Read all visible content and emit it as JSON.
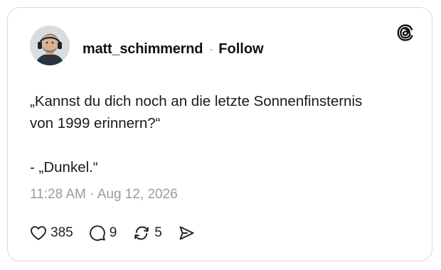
{
  "post": {
    "username": "matt_schimmernd",
    "separator": "·",
    "follow_label": "Follow",
    "text": "„Kannst du dich noch an die letzte Sonnenfinsternis\nvon 1999 erinnern?“\n\n- „Dunkel.“",
    "timestamp": "11:28 AM · Aug 12, 2026"
  },
  "actions": {
    "likes": "385",
    "replies": "9",
    "reposts": "5"
  },
  "icons": {
    "logo": "threads-logo-icon",
    "like": "heart-icon",
    "reply": "comment-icon",
    "repost": "repost-icon",
    "share": "send-icon"
  },
  "colors": {
    "text": "#111111",
    "muted": "#9b9b9b",
    "border": "#d9d9d9"
  }
}
